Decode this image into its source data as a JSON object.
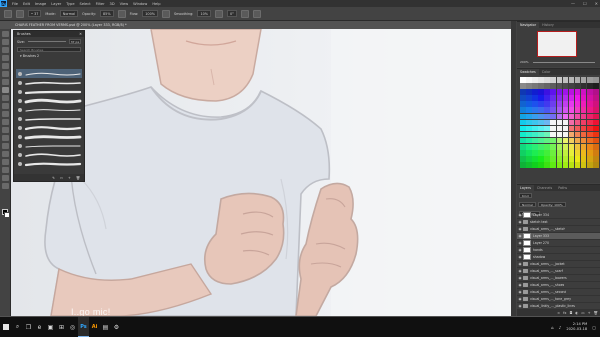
{
  "app": {
    "logo": "Ps",
    "menu": [
      "File",
      "Edit",
      "Image",
      "Layer",
      "Type",
      "Select",
      "Filter",
      "3D",
      "View",
      "Window",
      "Help"
    ],
    "window_controls": [
      "—",
      "☐",
      "✕"
    ]
  },
  "options_bar": {
    "mode_label": "Mode:",
    "mode_value": "Normal",
    "opacity_label": "Opacity:",
    "opacity_value": "85%",
    "flow_label": "Flow:",
    "flow_value": "100%",
    "smoothing_label": "Smoothing:",
    "smoothing_value": "10%",
    "angle_value": "0°"
  },
  "document": {
    "tab_title": "CHARIS FEATHER FROM VERMS.psd @ 200% (Layer 333, RGB/8) *"
  },
  "canvas": {
    "subtitle": "I..go mic!"
  },
  "brushes_panel": {
    "title": "Brushes",
    "size_label": "Size:",
    "size_value": "37 px",
    "search_placeholder": "Search Brushes",
    "group_name": "Brushes 2",
    "brush_count": 11,
    "selected_index": 0,
    "footer_icons": [
      "brush-settings-icon",
      "new-group-icon",
      "new-brush-icon",
      "trash-icon"
    ]
  },
  "navigator_panel": {
    "tabs": [
      "Navigator",
      "History"
    ],
    "zoom_value": "200%"
  },
  "swatches_panel": {
    "tabs": [
      "Swatches",
      "Color"
    ]
  },
  "layers_panel": {
    "tabs": [
      "Layers",
      "Channels",
      "Paths"
    ],
    "kind_filter": "Kind",
    "blend_mode": "Normal",
    "opacity_label": "Opacity: 100%",
    "fill_label": "Fill: 100%",
    "layers": [
      {
        "name": "Layer 334",
        "type": "layer",
        "visible": true,
        "selected": false
      },
      {
        "name": "sketch text",
        "type": "folder",
        "visible": true,
        "selected": false
      },
      {
        "name": "visual_arms_..._sketch",
        "type": "folder",
        "visible": true,
        "selected": false
      },
      {
        "name": "Layer 333",
        "type": "layer",
        "visible": true,
        "selected": true
      },
      {
        "name": "Layer 270",
        "type": "layer",
        "visible": true,
        "selected": false
      },
      {
        "name": "hands",
        "type": "layer",
        "visible": true,
        "selected": false
      },
      {
        "name": "shadow",
        "type": "layer",
        "visible": true,
        "selected": false
      },
      {
        "name": "visual_arms_..._jacket",
        "type": "folder",
        "visible": true,
        "selected": false
      },
      {
        "name": "visual_arms_..._scarf",
        "type": "folder",
        "visible": true,
        "selected": false
      },
      {
        "name": "visual_arms_..._bowers",
        "type": "folder",
        "visible": true,
        "selected": false
      },
      {
        "name": "visual_arms_..._shoes",
        "type": "folder",
        "visible": true,
        "selected": false
      },
      {
        "name": "visual_arms_..._second",
        "type": "folder",
        "visible": true,
        "selected": false
      },
      {
        "name": "visual_arms_..._tone_grey",
        "type": "folder",
        "visible": true,
        "selected": false
      },
      {
        "name": "visual_linkly_..._plastic_lines",
        "type": "folder",
        "visible": true,
        "selected": false
      }
    ]
  },
  "taskbar": {
    "time": "2:14 PM",
    "date": "2020-03-18",
    "apps": [
      "search-icon",
      "task-view-icon",
      "edge-icon",
      "file-explorer-icon",
      "store-icon",
      "chrome-icon",
      "photoshop-icon",
      "illustrator-icon",
      "folder-icon",
      "settings-icon"
    ]
  },
  "colors": {
    "accent": "#31a8ff",
    "panel_bg": "#3d3d3d",
    "canvas_bg": "#eaecef",
    "shirt": "#dfe3ea",
    "skin": "#e7c6b9",
    "outline": "#c3a9a1"
  }
}
